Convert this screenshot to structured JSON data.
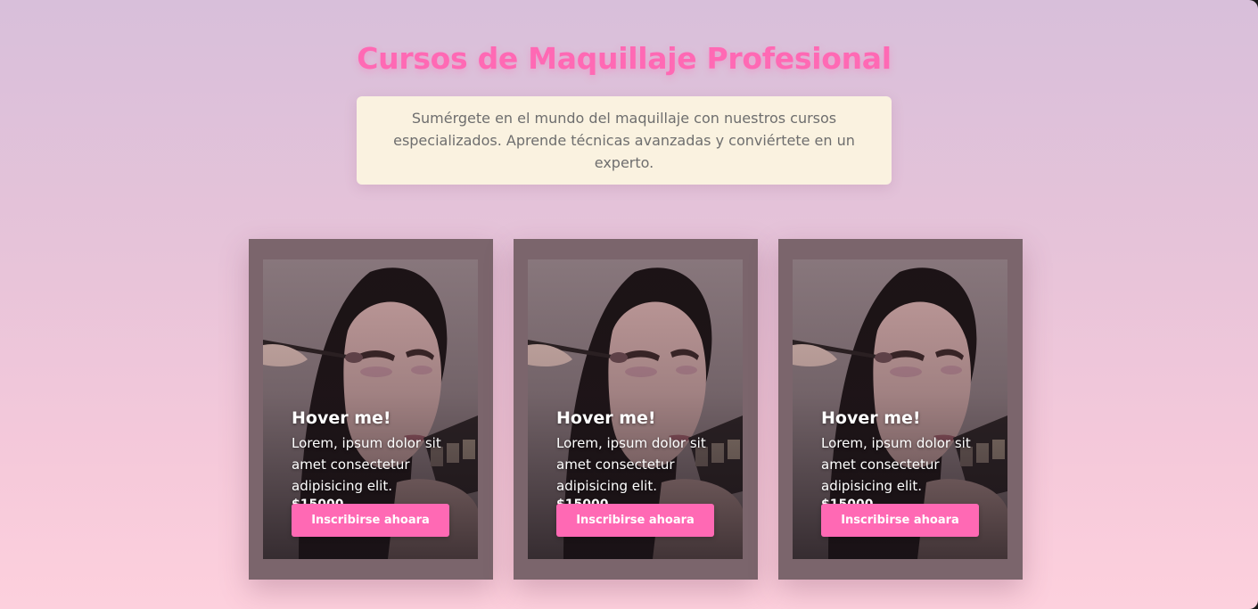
{
  "header": {
    "title": "Cursos de Maquillaje Profesional",
    "intro": "Sumérgete en el mundo del maquillaje con nuestros cursos especializados. Aprende técnicas avanzadas y conviértete en un experto."
  },
  "cards": [
    {
      "title": "Hover me!",
      "description": "Lorem, ipsum dolor sit amet consectetur adipisicing elit.",
      "price": "$15000",
      "button_label": "Inscribirse ahoara",
      "image": "makeup-model-photo"
    },
    {
      "title": "Hover me!",
      "description": "Lorem, ipsum dolor sit amet consectetur adipisicing elit.",
      "price": "$15000",
      "button_label": "Inscribirse ahoara",
      "image": "makeup-model-photo"
    },
    {
      "title": "Hover me!",
      "description": "Lorem, ipsum dolor sit amet consectetur adipisicing elit.",
      "price": "$15000",
      "button_label": "Inscribirse ahoara",
      "image": "makeup-model-photo"
    }
  ],
  "colors": {
    "accent": "#ff69b4",
    "intro_background": "#faf2e0",
    "card_frame": "#7b656c"
  }
}
